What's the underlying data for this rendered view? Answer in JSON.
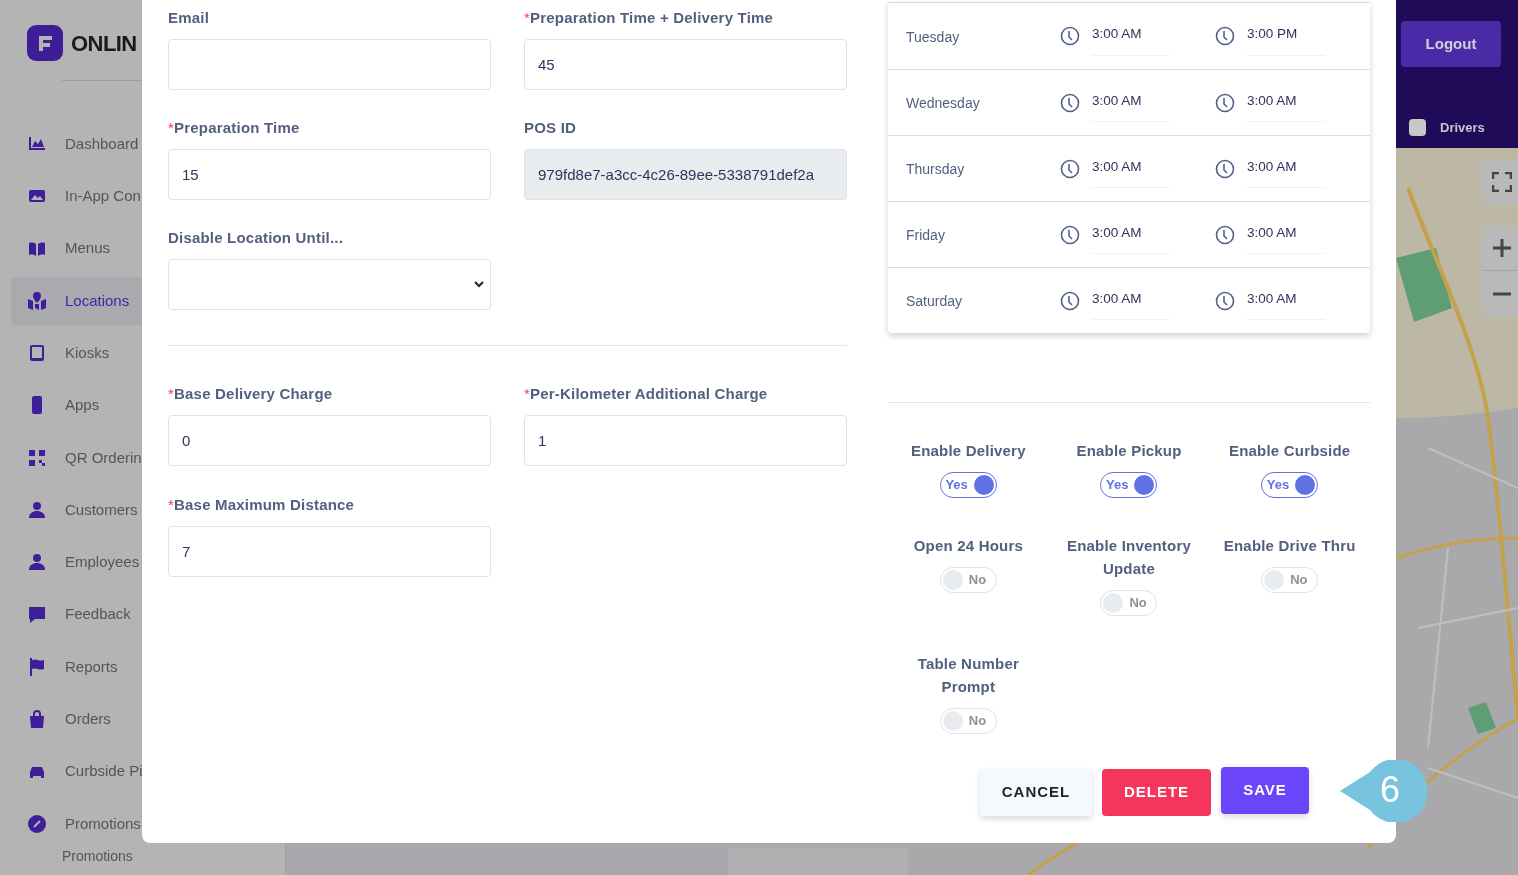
{
  "sidebar": {
    "logo_text": "ONLIN",
    "items": [
      {
        "label": "Dashboard",
        "selected": false
      },
      {
        "label": "In-App Con",
        "selected": false
      },
      {
        "label": "Menus",
        "selected": false
      },
      {
        "label": "Locations",
        "selected": true
      },
      {
        "label": "Kiosks",
        "selected": false
      },
      {
        "label": "Apps",
        "selected": false
      },
      {
        "label": "QR Orderin",
        "selected": false
      },
      {
        "label": "Customers",
        "selected": false
      },
      {
        "label": "Employees",
        "selected": false
      },
      {
        "label": "Feedback",
        "selected": false
      },
      {
        "label": "Reports",
        "selected": false
      },
      {
        "label": "Orders",
        "selected": false
      },
      {
        "label": "Curbside Pi",
        "selected": false
      },
      {
        "label": "Promotions",
        "selected": false
      }
    ],
    "sub_label": "Promotions"
  },
  "header": {
    "logout_button": "Logout",
    "drivers_filter": {
      "label": "Drivers",
      "checked": false
    }
  },
  "modal": {
    "fields": [
      {
        "label": "Email",
        "kind": "text"
      },
      {
        "label": "Preparation Time + Delivery Time",
        "mark": "*",
        "kind": "text",
        "value": "45"
      },
      {
        "label": "Preparation Time",
        "mark": "*",
        "kind": "text",
        "value": "15"
      },
      {
        "label": "POS ID",
        "kind": "readonly",
        "value": "979fd8e7-a3cc-4c26-89ee-5338791def2a"
      },
      {
        "label": "Disable Location Until...",
        "kind": "select"
      }
    ],
    "charges": [
      {
        "label": "Base Delivery Charge",
        "mark": "*",
        "kind": "text",
        "value": "0"
      },
      {
        "label": "Per-Kilometer Additional Charge",
        "mark": "*",
        "kind": "text",
        "value": "1"
      },
      {
        "label": "Base Maximum Distance",
        "mark": "*",
        "kind": "text",
        "value": "7"
      }
    ],
    "schedule": [
      {
        "day": "Tuesday",
        "open": "3:00 AM",
        "close": "3:00 PM"
      },
      {
        "day": "Wednesday",
        "open": "3:00 AM",
        "close": "3:00 AM"
      },
      {
        "day": "Thursday",
        "open": "3:00 AM",
        "close": "3:00 AM"
      },
      {
        "day": "Friday",
        "open": "3:00 AM",
        "close": "3:00 AM"
      },
      {
        "day": "Saturday",
        "open": "3:00 AM",
        "close": "3:00 AM"
      }
    ],
    "toggles": [
      {
        "label": "Enable Delivery",
        "on": true,
        "state_text": "Yes"
      },
      {
        "label": "Enable Pickup",
        "on": true,
        "state_text": "Yes"
      },
      {
        "label": "Enable Curbside",
        "on": true,
        "state_text": "Yes"
      },
      {
        "label": "Open 24 Hours",
        "on": false,
        "state_text": "No"
      },
      {
        "label": "Enable Inventory Update",
        "on": false,
        "state_text": "No"
      },
      {
        "label": "Enable Drive Thru",
        "on": false,
        "state_text": "No"
      },
      {
        "label": "Table Number Prompt",
        "on": false,
        "state_text": "No"
      }
    ],
    "buttons": [
      {
        "label": "CANCEL",
        "kind": "cancel"
      },
      {
        "label": "DELETE",
        "kind": "delete"
      },
      {
        "label": "SAVE",
        "kind": "save"
      }
    ]
  },
  "callout": {
    "number": "6"
  }
}
